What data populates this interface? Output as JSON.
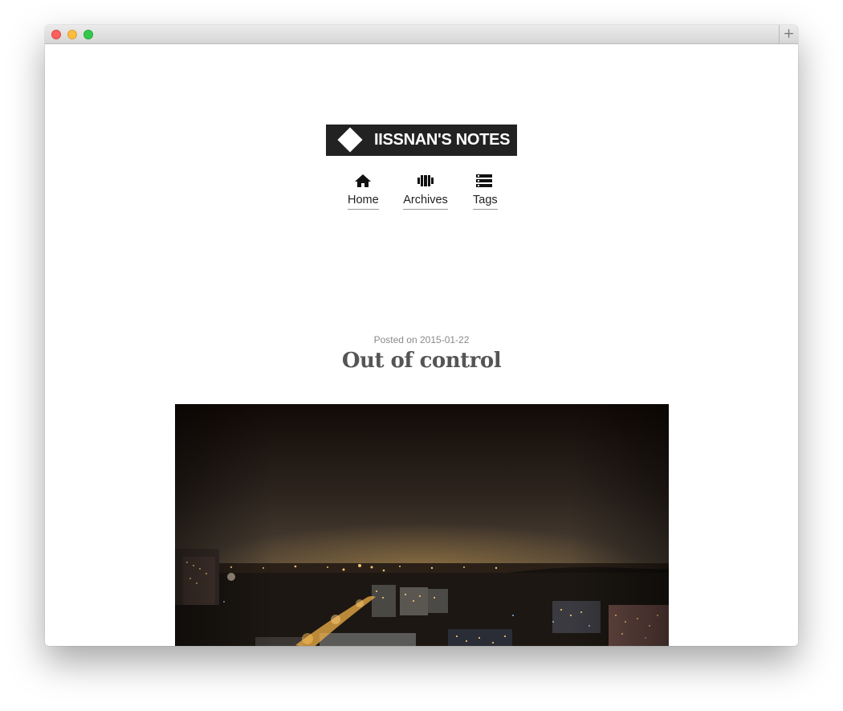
{
  "window": {
    "new_tab_symbol": "+"
  },
  "site": {
    "logo_text": "IISSNAN'S NOTES"
  },
  "nav": {
    "items": [
      {
        "label": "Home",
        "icon": "home-icon"
      },
      {
        "label": "Archives",
        "icon": "archives-icon"
      },
      {
        "label": "Tags",
        "icon": "tags-icon"
      }
    ]
  },
  "post": {
    "posted_prefix": "Posted on",
    "date": "2015-01-22",
    "title": "Out of control",
    "image": "night-cityscape-photo"
  },
  "colors": {
    "logo_bg": "#222222",
    "title": "#555555",
    "meta": "#8a8a8a"
  }
}
